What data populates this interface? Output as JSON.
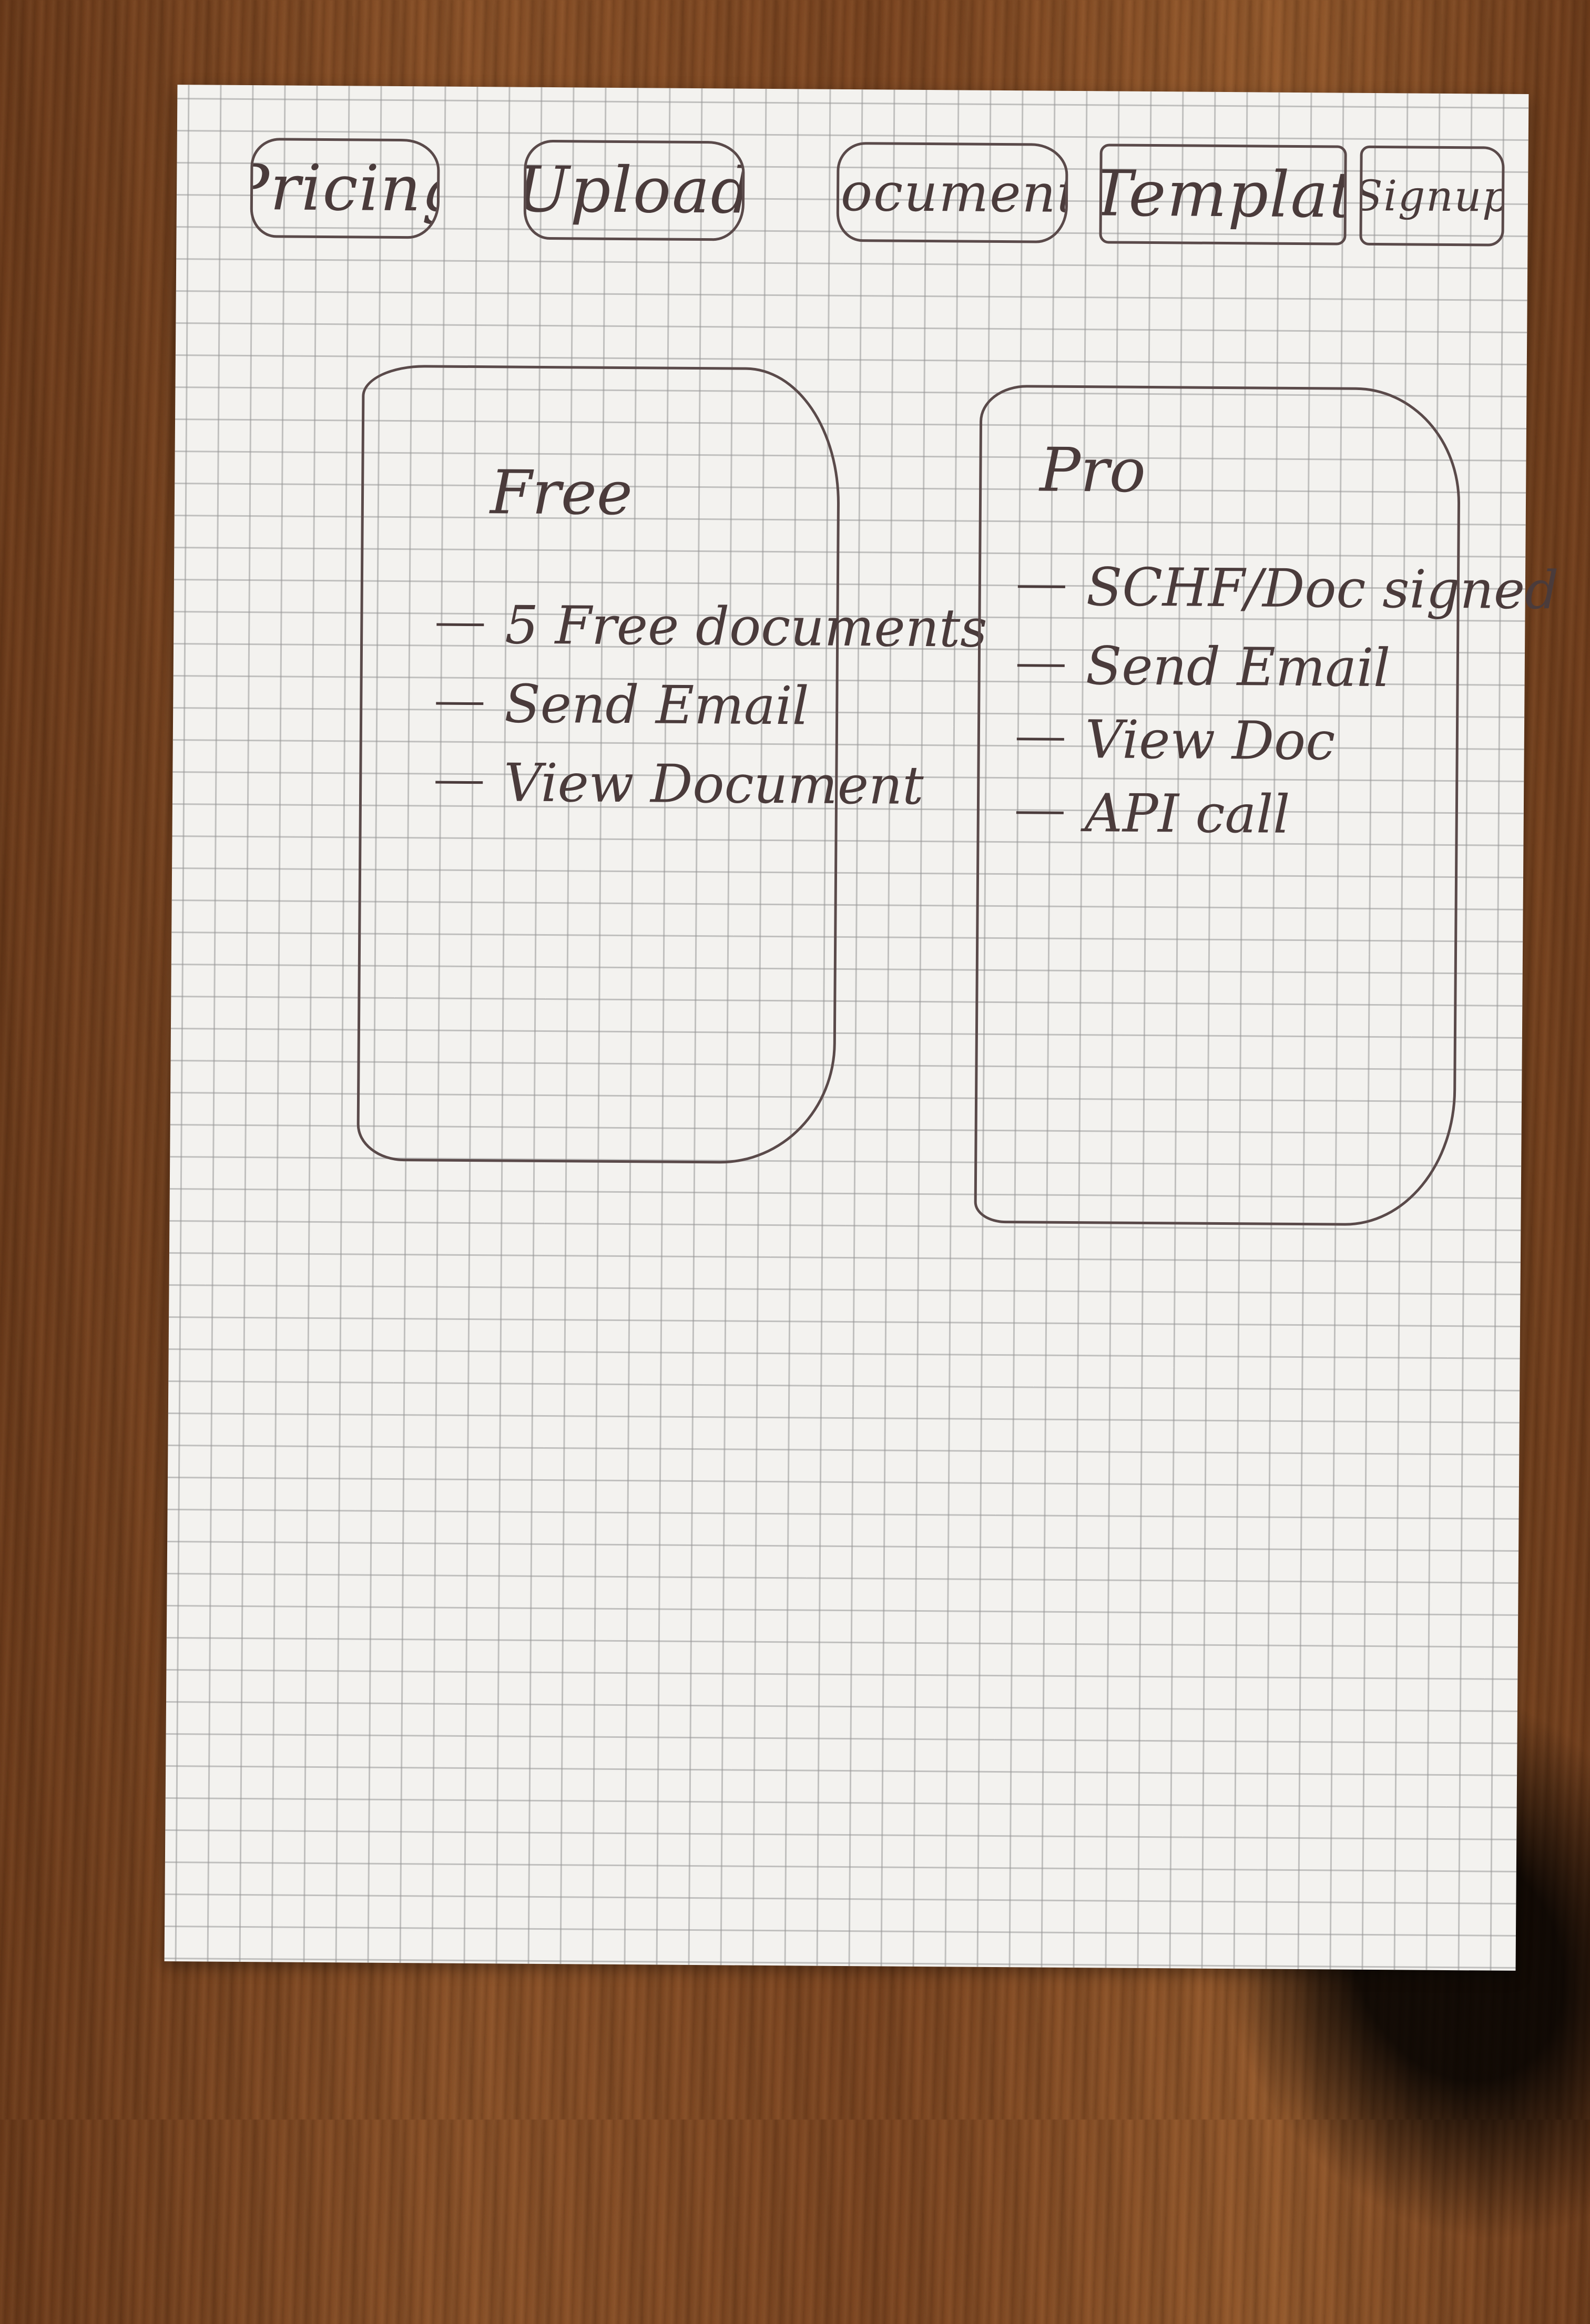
{
  "nav": {
    "tabs": [
      {
        "label": "Pricing"
      },
      {
        "label": "Upload"
      },
      {
        "label": "Documents"
      },
      {
        "label": "Templat"
      },
      {
        "label": "Signup"
      }
    ]
  },
  "plans": {
    "free": {
      "title": "Free",
      "features": [
        "5 Free documents",
        "Send Email",
        "View Document"
      ]
    },
    "pro": {
      "title": "Pro",
      "features": [
        "SCHF/Doc signed",
        "Send Email",
        "View Doc",
        "API call"
      ]
    }
  }
}
